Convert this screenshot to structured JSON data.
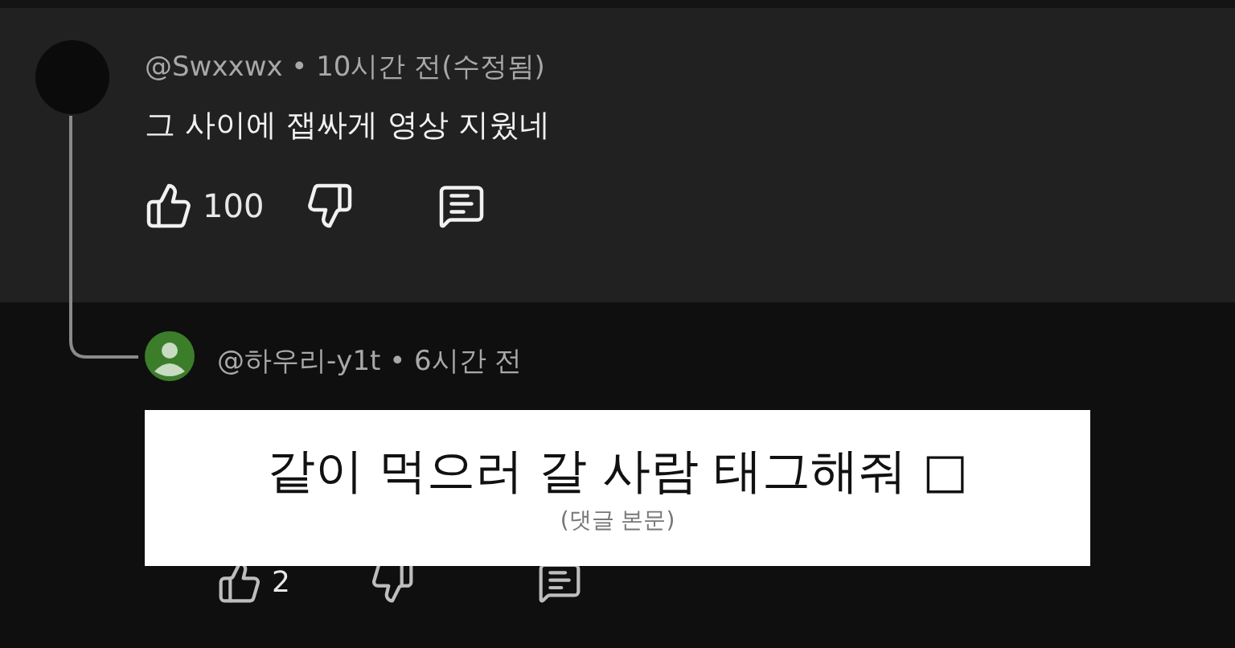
{
  "comment": {
    "header": "@Swxxwx • 10시간 전(수정됨)",
    "text": "그 사이에 잽싸게 영상 지웠네",
    "likes": "100"
  },
  "reply": {
    "header": "@하우리-y1t • 6시간 전",
    "likes": "2"
  },
  "caption": {
    "text": "같이 먹으러 갈 사람 태그해줘 □",
    "note": "(댓글 본문)"
  }
}
